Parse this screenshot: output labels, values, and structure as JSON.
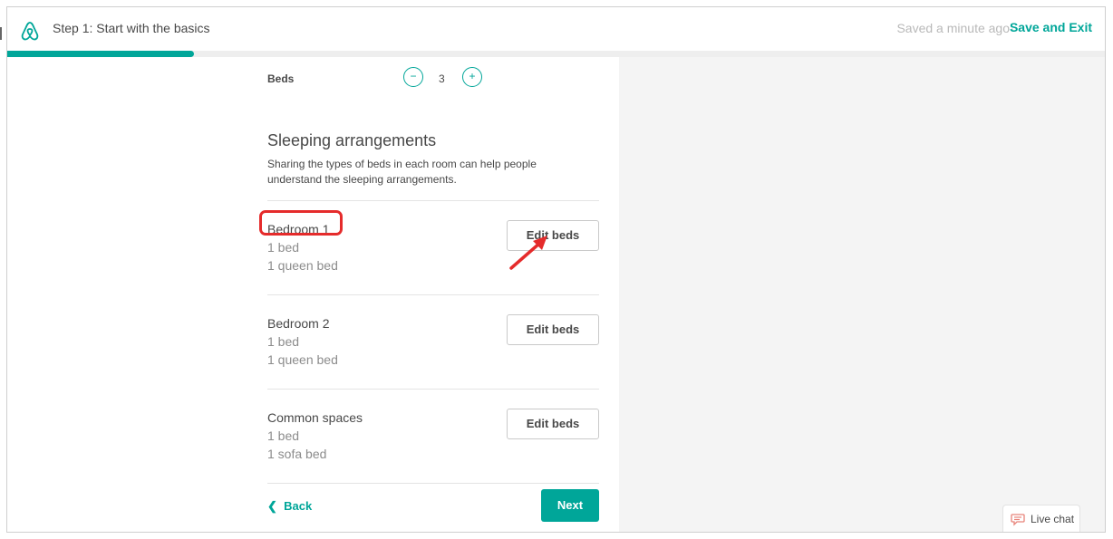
{
  "header": {
    "step_title": "Step 1: Start with the basics",
    "saved_status": "Saved a minute ago",
    "separator": "·",
    "save_exit_label": "Save and Exit",
    "logo_icon": "airbnb-logo-icon"
  },
  "progress": {
    "fraction": 0.17,
    "color": "#00a699"
  },
  "beds": {
    "label": "Beds",
    "value": "3",
    "minus": "−",
    "plus": "+"
  },
  "sleeping": {
    "title": "Sleeping arrangements",
    "description": "Sharing the types of beds in each room can help people understand the sleeping arrangements."
  },
  "rooms": [
    {
      "name": "Bedroom 1",
      "beds_count": "1 bed",
      "bed_type": "1 queen bed",
      "button": "Edit beds"
    },
    {
      "name": "Bedroom 2",
      "beds_count": "1 bed",
      "bed_type": "1 queen bed",
      "button": "Edit beds"
    },
    {
      "name": "Common spaces",
      "beds_count": "1 bed",
      "bed_type": "1 sofa bed",
      "button": "Edit beds"
    }
  ],
  "footer": {
    "back_label": "Back",
    "next_label": "Next"
  },
  "live_chat": {
    "label": "Live chat",
    "icon": "chat-bubble-icon"
  },
  "colors": {
    "accent": "#00a699",
    "annotation": "#e52b2b",
    "panel": "#f4f4f4"
  }
}
